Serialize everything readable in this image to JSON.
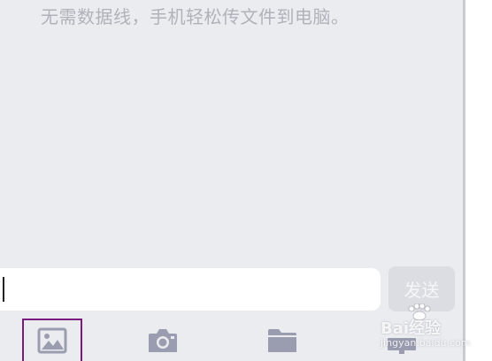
{
  "chat": {
    "hint_text": "无需数据线，手机轻松传文件到电脑。"
  },
  "composer": {
    "input_value": "",
    "send_label": "发送"
  },
  "toolbar": {
    "items": [
      {
        "icon": "image-icon",
        "selected": true
      },
      {
        "icon": "camera-icon",
        "selected": false
      },
      {
        "icon": "folder-icon",
        "selected": false
      },
      {
        "icon": "computer-icon",
        "selected": false
      }
    ]
  },
  "watermark": {
    "brand": "Bai经验",
    "url": "jingyan.baidu.com"
  },
  "colors": {
    "background": "#ebecf0",
    "icon": "#9a9db0",
    "selected_outline": "#7a1a7f",
    "send_button": "#dcdde2"
  }
}
